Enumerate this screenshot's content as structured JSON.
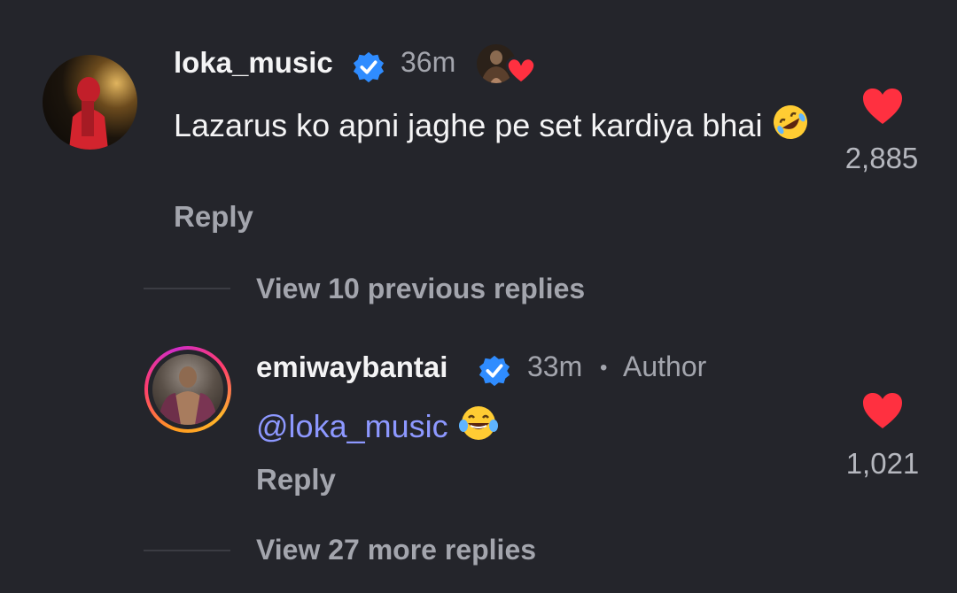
{
  "comment": {
    "username": "loka_music",
    "time": "36m",
    "text": "Lazarus ko apni  jaghe pe set kardiya bhai",
    "emoji": "rolling-on-floor-laughing-emoji",
    "reply_label": "Reply",
    "like_count": "2,885",
    "verified_color": "#2f8cff",
    "heart_color": "#ff3040"
  },
  "view_previous": {
    "label": "View 10 previous replies"
  },
  "reply": {
    "username": "emiwaybantai",
    "time": "33m",
    "separator": "•",
    "author_label": "Author",
    "mention": "@loka_music",
    "emoji": "tears-of-joy-emoji",
    "reply_label": "Reply",
    "like_count": "1,021",
    "mention_color": "#8d98ff"
  },
  "view_more": {
    "label": "View 27 more replies"
  }
}
